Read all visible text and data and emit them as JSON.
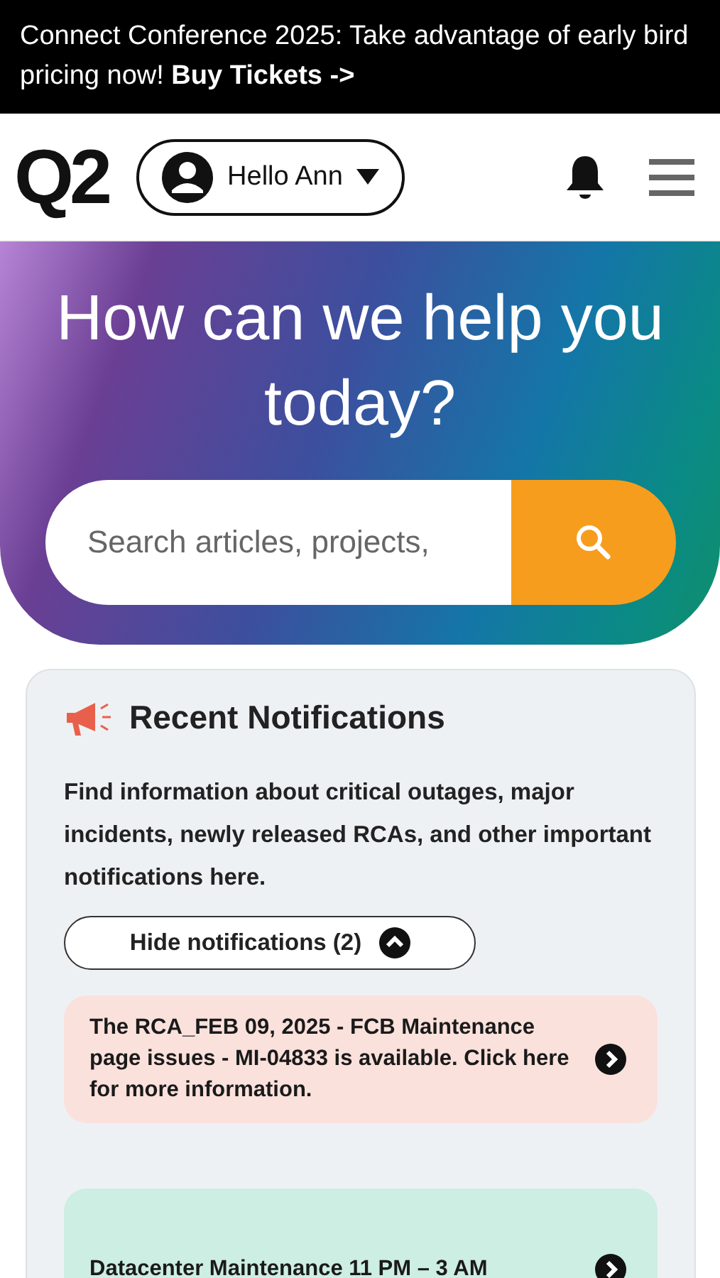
{
  "banner": {
    "text": "Connect Conference 2025: Take advantage of early bird pricing now!",
    "link": "Buy Tickets ->"
  },
  "header": {
    "logo": "Q2",
    "user_menu": "Hello Ann"
  },
  "hero": {
    "title": "How can we help you today?",
    "search": {
      "placeholder": "Search articles, projects,"
    }
  },
  "notifications": {
    "title": "Recent Notifications",
    "description": "Find information about critical outages, major incidents, newly released RCAs, and other important notifications here.",
    "toggle": "Hide notifications (2)",
    "expanded": true,
    "items": [
      {
        "text": "The RCA_FEB 09, 2025 - FCB Maintenance page issues - MI-04833 is available. Click here for more information.",
        "color": "#fbe1dc"
      },
      {
        "text": "Datacenter Maintenance 11 PM – 3 AM",
        "color": "#cdeee2"
      }
    ]
  }
}
